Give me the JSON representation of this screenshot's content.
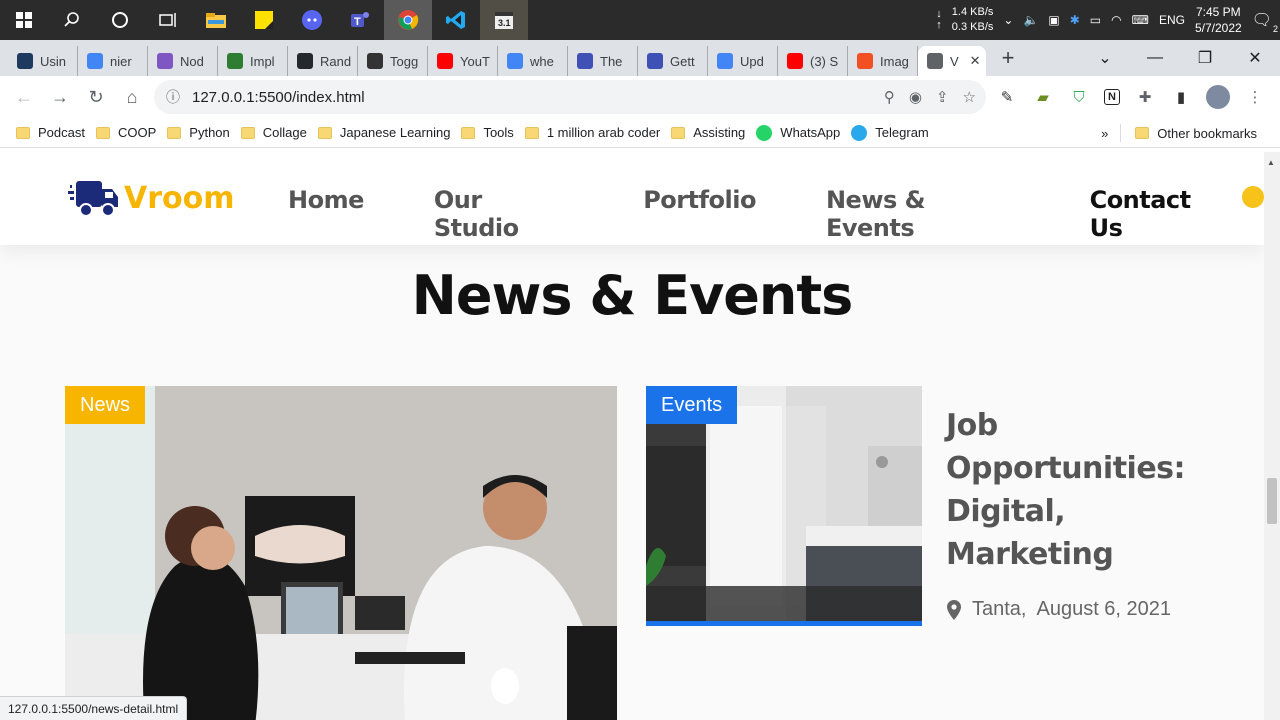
{
  "taskbar": {
    "net_down": "1.4 KB/s",
    "net_up": "0.3 KB/s",
    "language": "ENG",
    "time": "7:45 PM",
    "date": "5/7/2022",
    "notifications": "2"
  },
  "tabs": [
    {
      "label": "Usin",
      "color": "#1e3a5f"
    },
    {
      "label": "nier",
      "color": "#4285f4"
    },
    {
      "label": "Nod",
      "color": "#7e57c2"
    },
    {
      "label": "Impl",
      "color": "#2e7d32"
    },
    {
      "label": "Rand",
      "color": "#24292e"
    },
    {
      "label": "Togg",
      "color": "#333333"
    },
    {
      "label": "YouT",
      "color": "#ff0000"
    },
    {
      "label": "whe",
      "color": "#4285f4"
    },
    {
      "label": "The",
      "color": "#3f51b5"
    },
    {
      "label": "Gett",
      "color": "#3f51b5"
    },
    {
      "label": "Upd",
      "color": "#4285f4"
    },
    {
      "label": "(3) S",
      "color": "#ff0000"
    },
    {
      "label": "Imag",
      "color": "#f25022"
    },
    {
      "label": "V",
      "color": "#5f6368"
    }
  ],
  "address": {
    "url": "127.0.0.1:5500/index.html"
  },
  "bookmarks": [
    {
      "label": "Podcast"
    },
    {
      "label": "COOP"
    },
    {
      "label": "Python"
    },
    {
      "label": "Collage"
    },
    {
      "label": "Japanese Learning"
    },
    {
      "label": "Tools"
    },
    {
      "label": "1 million arab coder"
    },
    {
      "label": "Assisting"
    },
    {
      "label": "WhatsApp"
    },
    {
      "label": "Telegram"
    }
  ],
  "bookmarks_overflow": "»",
  "other_bookmarks": "Other bookmarks",
  "site": {
    "logo_text": "Vroom",
    "nav": [
      "Home",
      "Our Studio",
      "Portfolio",
      "News & Events",
      "Contact Us"
    ],
    "section_title": "News & Events",
    "card_main_badge": "News",
    "card_side_badge": "Events",
    "card_side_title": "Job Opportunities: Digital, Marketing",
    "card_side_location": "Tanta,",
    "card_side_date": "August 6, 2021"
  },
  "status_bar_url": "127.0.0.1:5500/news-detail.html",
  "colors": {
    "brand_yellow": "#f7b500",
    "events_blue": "#1a73e8"
  }
}
